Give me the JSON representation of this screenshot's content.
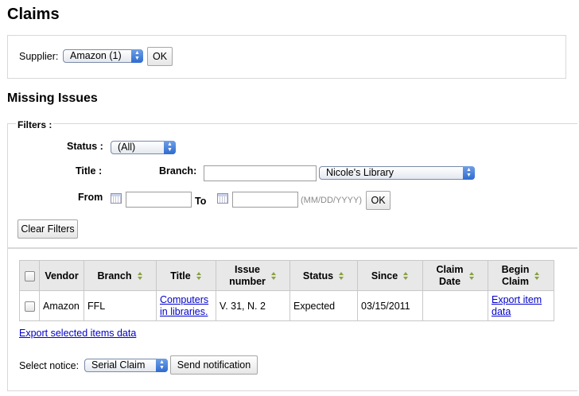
{
  "page": {
    "title": "Claims"
  },
  "supplier": {
    "label": "Supplier:",
    "selected": "Amazon (1)",
    "ok_label": "OK"
  },
  "missing": {
    "heading": "Missing Issues"
  },
  "filters": {
    "legend": "Filters :",
    "status_label": "Status :",
    "status_selected": "(All)",
    "title_label": "Title :",
    "branch_label": "Branch:",
    "title_value": "",
    "branch_selected": "Nicole's Library",
    "from_label": "From",
    "to_label": "To",
    "date_format_hint": "(MM/DD/YYYY)",
    "ok_label": "OK",
    "clear_label": "Clear Filters"
  },
  "table": {
    "columns": [
      "",
      "Vendor",
      "Branch",
      "Title",
      "Issue number",
      "Status",
      "Since",
      "Claim Date",
      "Begin Claim"
    ],
    "col_issue_1": "Issue",
    "col_issue_2": "number",
    "col_claim_1": "Claim",
    "col_claim_2": "Date",
    "col_begin_1": "Begin",
    "col_begin_2": "Claim",
    "rows": [
      {
        "vendor": "Amazon",
        "branch": "FFL",
        "title_1": "Computers",
        "title_2": "in libraries.",
        "issue": "V. 31, N. 2",
        "status": "Expected",
        "since": "03/15/2011",
        "claim_date": "",
        "export_1": "Export item",
        "export_2": "data"
      }
    ]
  },
  "export_selected_label": "Export selected items data",
  "notice": {
    "label": "Select notice:",
    "selected": "Serial Claim",
    "send_label": "Send notification"
  },
  "icons": {
    "select_arrows": "updown-arrows-icon",
    "calendar": "calendar-icon",
    "sort": "sort-icon"
  }
}
